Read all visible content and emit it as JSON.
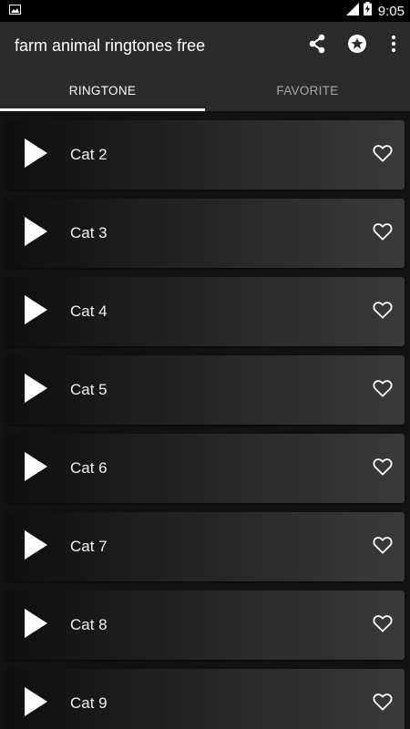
{
  "status_bar": {
    "time": "9:05",
    "icons": [
      "image-notification-icon",
      "signal-icon",
      "battery-charging-icon"
    ]
  },
  "app_bar": {
    "title": "farm animal ringtones free",
    "actions": [
      "share-icon",
      "star-icon",
      "more-vert-icon"
    ]
  },
  "tabs": [
    {
      "label": "RINGTONE",
      "active": true
    },
    {
      "label": "FAVORITE",
      "active": false
    }
  ],
  "ringtones": [
    {
      "title": "Cat 2"
    },
    {
      "title": "Cat 3"
    },
    {
      "title": "Cat 4"
    },
    {
      "title": "Cat 5"
    },
    {
      "title": "Cat 6"
    },
    {
      "title": "Cat 7"
    },
    {
      "title": "Cat 8"
    },
    {
      "title": "Cat 9"
    }
  ],
  "colors": {
    "app_bar": "#2b2b2b",
    "status_bar": "#000000",
    "background": "#121212",
    "tab_indicator": "#ffffff"
  }
}
